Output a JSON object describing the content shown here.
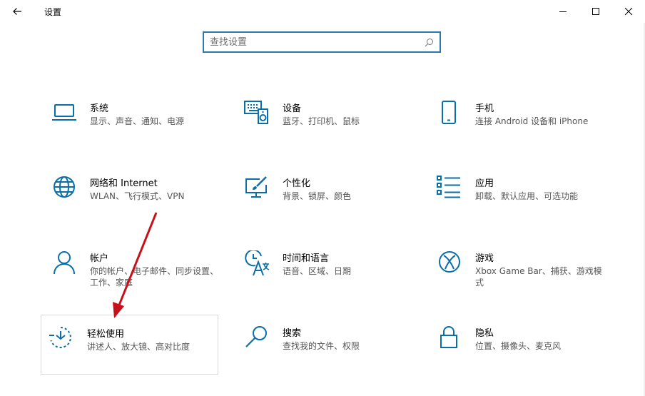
{
  "window": {
    "title": "设置"
  },
  "search": {
    "placeholder": "查找设置"
  },
  "colors": {
    "accent": "#0a6ea8",
    "annotation_arrow": "#c8101a"
  },
  "tiles": [
    {
      "name": "系统",
      "desc": "显示、声音、通知、电源",
      "icon": "laptop-icon"
    },
    {
      "name": "设备",
      "desc": "蓝牙、打印机、鼠标",
      "icon": "keyboard-speaker-icon"
    },
    {
      "name": "手机",
      "desc": "连接 Android 设备和 iPhone",
      "icon": "phone-icon"
    },
    {
      "name": "网络和 Internet",
      "desc": "WLAN、飞行模式、VPN",
      "icon": "globe-icon"
    },
    {
      "name": "个性化",
      "desc": "背景、锁屏、颜色",
      "icon": "paint-monitor-icon"
    },
    {
      "name": "应用",
      "desc": "卸载、默认应用、可选功能",
      "icon": "app-list-icon"
    },
    {
      "name": "帐户",
      "desc": "你的帐户、电子邮件、同步设置、工作、家庭",
      "icon": "person-icon"
    },
    {
      "name": "时间和语言",
      "desc": "语音、区域、日期",
      "icon": "time-language-icon"
    },
    {
      "name": "游戏",
      "desc": "Xbox Game Bar、捕获、游戏模式",
      "icon": "xbox-icon"
    },
    {
      "name": "轻松使用",
      "desc": "讲述人、放大镜、高对比度",
      "icon": "ease-of-access-icon"
    },
    {
      "name": "搜索",
      "desc": "查找我的文件、权限",
      "icon": "search-magnifier-icon"
    },
    {
      "name": "隐私",
      "desc": "位置、摄像头、麦克风",
      "icon": "lock-icon"
    }
  ]
}
